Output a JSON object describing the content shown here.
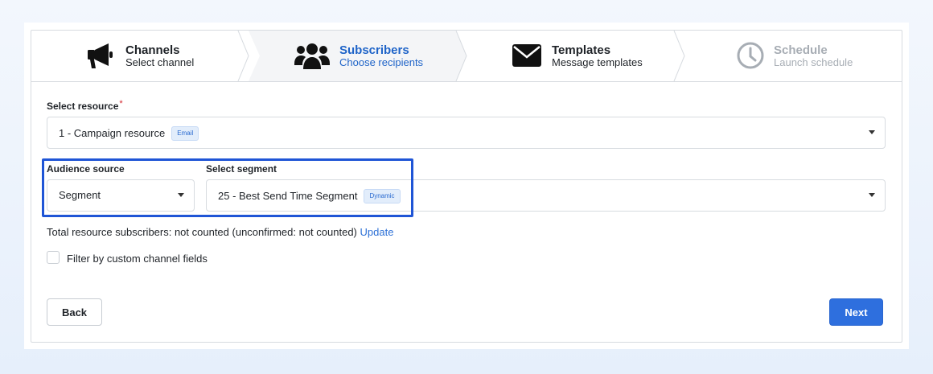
{
  "steps": [
    {
      "title": "Channels",
      "subtitle": "Select channel",
      "icon": "megaphone-icon",
      "state": "done"
    },
    {
      "title": "Subscribers",
      "subtitle": "Choose recipients",
      "icon": "users-icon",
      "state": "active"
    },
    {
      "title": "Templates",
      "subtitle": "Message templates",
      "icon": "envelope-icon",
      "state": "default"
    },
    {
      "title": "Schedule",
      "subtitle": "Launch schedule",
      "icon": "clock-icon",
      "state": "disabled"
    }
  ],
  "resource": {
    "label": "Select resource",
    "required_mark": "*",
    "value": "1 - Campaign resource",
    "tag": "Email"
  },
  "audience": {
    "label": "Audience source",
    "value": "Segment"
  },
  "segment": {
    "label": "Select segment",
    "value": "25 - Best Send Time Segment",
    "tag": "Dynamic"
  },
  "info": {
    "text": "Total resource subscribers: not counted (unconfirmed: not counted)",
    "link": "Update"
  },
  "filter": {
    "label": "Filter by custom channel fields",
    "checked": false
  },
  "buttons": {
    "back": "Back",
    "next": "Next"
  },
  "colors": {
    "accent": "#2e6fde",
    "active_step_text": "#1f64c8",
    "highlight_border": "#1f55d6",
    "required": "#d3272f"
  }
}
